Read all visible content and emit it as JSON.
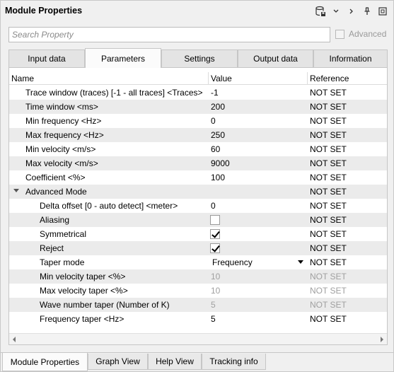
{
  "window": {
    "title": "Module Properties"
  },
  "toolbar_icons": [
    "save-database-icon",
    "chevron-down-icon",
    "chevron-right-icon",
    "pin-icon",
    "popout-icon"
  ],
  "search": {
    "placeholder": "Search Property",
    "value": ""
  },
  "advanced": {
    "label": "Advanced",
    "checked": false
  },
  "tabs": [
    {
      "label": "Input data",
      "active": false
    },
    {
      "label": "Parameters",
      "active": true
    },
    {
      "label": "Settings",
      "active": false
    },
    {
      "label": "Output data",
      "active": false
    },
    {
      "label": "Information",
      "active": false
    }
  ],
  "grid": {
    "headers": {
      "name": "Name",
      "value": "Value",
      "reference": "Reference"
    },
    "rows": [
      {
        "name": "Trace window (traces) [-1 - all traces] <Traces>",
        "value": "-1",
        "reference": "NOT SET"
      },
      {
        "name": "Time window <ms>",
        "value": "200",
        "reference": "NOT SET"
      },
      {
        "name": "Min frequency <Hz>",
        "value": "0",
        "reference": "NOT SET"
      },
      {
        "name": "Max frequency <Hz>",
        "value": "250",
        "reference": "NOT SET"
      },
      {
        "name": "Min velocity <m/s>",
        "value": "60",
        "reference": "NOT SET"
      },
      {
        "name": "Max velocity <m/s>",
        "value": "9000",
        "reference": "NOT SET"
      },
      {
        "name": "Coefficient <%>",
        "value": "100",
        "reference": "NOT SET"
      },
      {
        "name": "Advanced Mode",
        "value": "",
        "reference": "NOT SET"
      },
      {
        "name": "Delta offset [0 - auto detect] <meter>",
        "value": "0",
        "reference": "NOT SET"
      },
      {
        "name": "Aliasing",
        "checked": false,
        "reference": "NOT SET"
      },
      {
        "name": "Symmetrical",
        "checked": true,
        "reference": "NOT SET"
      },
      {
        "name": "Reject",
        "checked": true,
        "reference": "NOT SET"
      },
      {
        "name": "Taper mode",
        "value": "Frequency",
        "reference": "NOT SET"
      },
      {
        "name": "Min velocity taper <%>",
        "value": "10",
        "reference": "NOT SET"
      },
      {
        "name": "Max velocity taper <%>",
        "value": "10",
        "reference": "NOT SET"
      },
      {
        "name": "Wave number taper (Number of K)",
        "value": "5",
        "reference": "NOT SET"
      },
      {
        "name": "Frequency taper <Hz>",
        "value": "5",
        "reference": "NOT SET"
      }
    ]
  },
  "bottom_tabs": [
    {
      "label": "Module Properties",
      "active": true
    },
    {
      "label": "Graph View",
      "active": false
    },
    {
      "label": "Help View",
      "active": false
    },
    {
      "label": "Tracking info",
      "active": false
    }
  ]
}
